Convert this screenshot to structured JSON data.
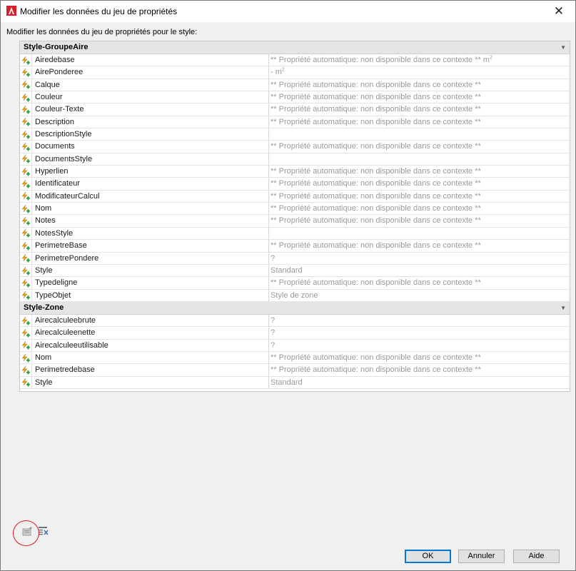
{
  "window": {
    "title": "Modifier les données du jeu de propriétés",
    "close_glyph": "✕"
  },
  "prompt": "Modifier les données du jeu de propriétés pour le style:",
  "groups": [
    {
      "title": "Style-GroupeAire",
      "rows": [
        {
          "name": "Airedebase",
          "value": "** Propriété automatique: non disponible dans ce contexte ** m",
          "sup": "2"
        },
        {
          "name": "AirePonderee",
          "value": "- m",
          "sup": "2"
        },
        {
          "name": "Calque",
          "value": "** Propriété automatique: non disponible dans ce contexte **"
        },
        {
          "name": "Couleur",
          "value": "** Propriété automatique: non disponible dans ce contexte **"
        },
        {
          "name": "Couleur-Texte",
          "value": "** Propriété automatique: non disponible dans ce contexte **"
        },
        {
          "name": "Description",
          "value": "** Propriété automatique: non disponible dans ce contexte **"
        },
        {
          "name": "DescriptionStyle",
          "value": ""
        },
        {
          "name": "Documents",
          "value": "** Propriété automatique: non disponible dans ce contexte **"
        },
        {
          "name": "DocumentsStyle",
          "value": ""
        },
        {
          "name": "Hyperlien",
          "value": "** Propriété automatique: non disponible dans ce contexte **"
        },
        {
          "name": "Identificateur",
          "value": "** Propriété automatique: non disponible dans ce contexte **"
        },
        {
          "name": "ModificateurCalcul",
          "value": "** Propriété automatique: non disponible dans ce contexte **"
        },
        {
          "name": "Nom",
          "value": "** Propriété automatique: non disponible dans ce contexte **"
        },
        {
          "name": "Notes",
          "value": "** Propriété automatique: non disponible dans ce contexte **"
        },
        {
          "name": "NotesStyle",
          "value": ""
        },
        {
          "name": "PerimetreBase",
          "value": "** Propriété automatique: non disponible dans ce contexte **"
        },
        {
          "name": "PerimetrePondere",
          "value": "?"
        },
        {
          "name": "Style",
          "value": "Standard"
        },
        {
          "name": "Typedeligne",
          "value": "** Propriété automatique: non disponible dans ce contexte **"
        },
        {
          "name": "TypeObjet",
          "value": "Style de zone"
        }
      ]
    },
    {
      "title": "Style-Zone",
      "rows": [
        {
          "name": "Airecalculeebrute",
          "value": "?"
        },
        {
          "name": "Airecalculeenette",
          "value": "?"
        },
        {
          "name": "Airecalculeeutilisable",
          "value": "?"
        },
        {
          "name": "Nom",
          "value": "** Propriété automatique: non disponible dans ce contexte **"
        },
        {
          "name": "Perimetredebase",
          "value": "** Propriété automatique: non disponible dans ce contexte **"
        },
        {
          "name": "Style",
          "value": "Standard"
        }
      ]
    }
  ],
  "icons": {
    "row_icon": "automatic-property-icon",
    "group_toggle": "chevron-down-icon",
    "add_property_set": "add-property-set-icon",
    "remove_property_set": "remove-property-set-icon"
  },
  "buttons": {
    "ok": "OK",
    "cancel": "Annuler",
    "help": "Aide"
  },
  "colors": {
    "app_icon": "#d9202a",
    "value_text": "#9a9a9a",
    "group_header_bg": "#e5e5e5",
    "default_button_border": "#0078d7",
    "annotation_circle": "#e0141e"
  }
}
